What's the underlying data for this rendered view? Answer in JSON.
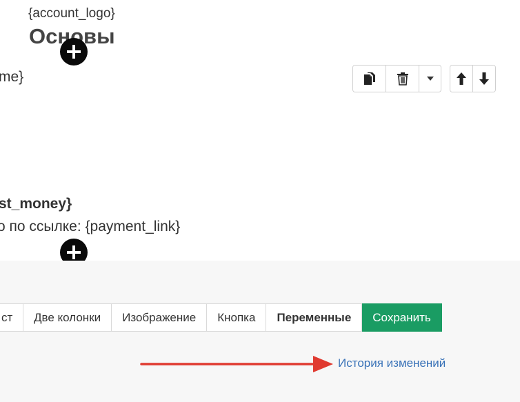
{
  "header": {
    "logo_variable": "{account_logo}",
    "title": "Основы"
  },
  "content": {
    "line1": "me}",
    "line2": "st_money}",
    "line3": "о по ссылке: {payment_link}"
  },
  "block_toolbar": {
    "copy_icon": "copy-icon",
    "delete_icon": "trash-icon",
    "dropdown_icon": "caret-down-icon",
    "move_up_icon": "arrow-up-icon",
    "move_down_icon": "arrow-down-icon"
  },
  "tabs": [
    {
      "label": "ст"
    },
    {
      "label": "Две колонки"
    },
    {
      "label": "Изображение"
    },
    {
      "label": "Кнопка"
    },
    {
      "label": "Переменные"
    },
    {
      "label": "Сохранить"
    }
  ],
  "footer": {
    "history_link": "История изменений"
  },
  "colors": {
    "save_button": "#1a9c63",
    "link": "#3a73b8",
    "annotation_arrow": "#e03a30"
  }
}
